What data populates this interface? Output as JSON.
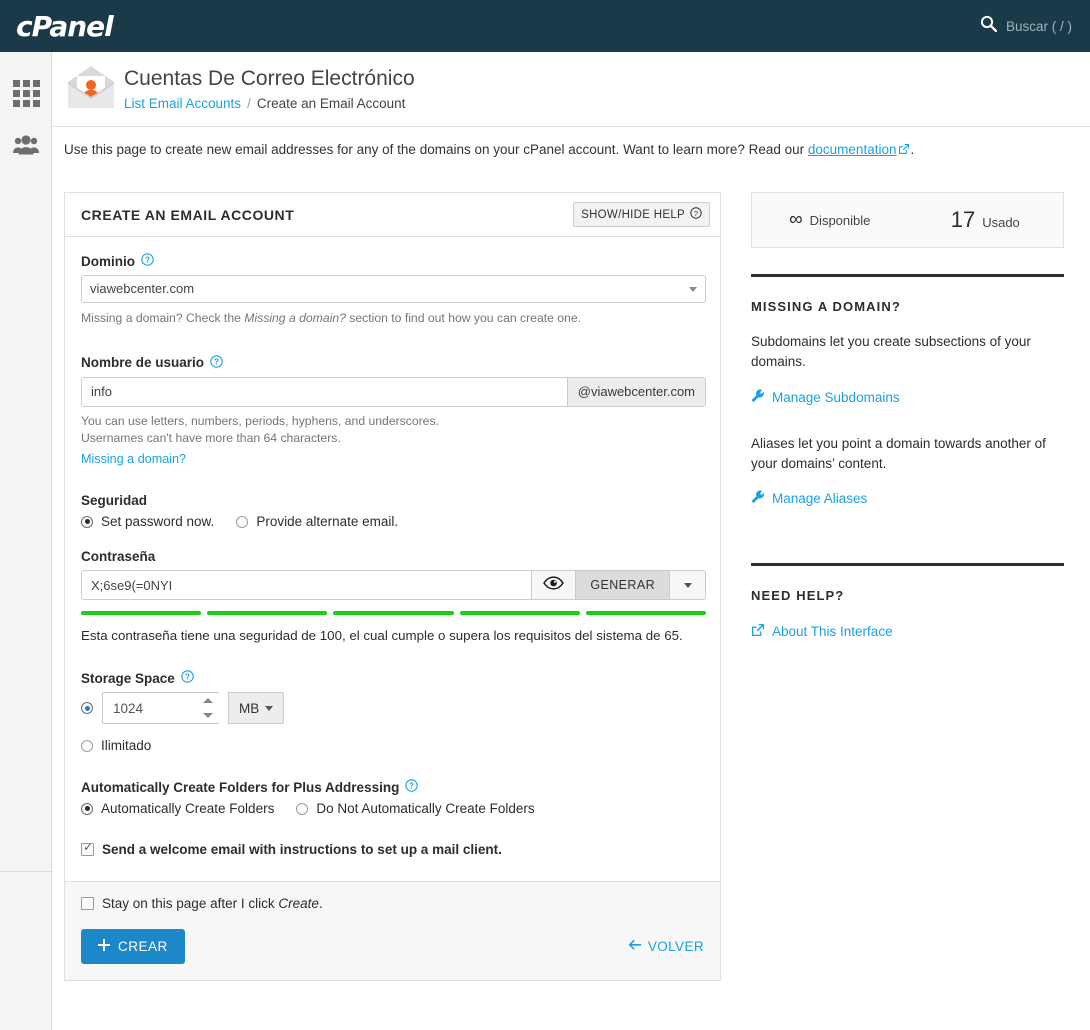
{
  "topbar": {
    "brand": "cPanel",
    "search_placeholder": "Buscar ( / )",
    "search_icon": "search-icon"
  },
  "rail": {
    "items": [
      {
        "icon": "grid-apps-icon",
        "name": "apps"
      },
      {
        "icon": "users-group-icon",
        "name": "users"
      }
    ]
  },
  "page_header": {
    "icon": "email-envelope-person-icon",
    "title": "Cuentas De Correo Electrónico",
    "breadcrumb": {
      "link": "List Email Accounts",
      "separator": "/",
      "current": "Create an Email Account"
    }
  },
  "intro": {
    "text_before": "Use this page to create new email addresses for any of the domains on your cPanel account. Want to learn more? Read our ",
    "link": "documentation",
    "text_after": "."
  },
  "form": {
    "title": "CREATE AN EMAIL ACCOUNT",
    "help_button": "SHOW/HIDE HELP",
    "domain": {
      "label": "Dominio",
      "value": "viawebcenter.com",
      "hint_before": "Missing a domain? Check the ",
      "hint_em": "Missing a domain?",
      "hint_after": " section to find out how you can create one."
    },
    "username": {
      "label": "Nombre de usuario",
      "value": "info",
      "addon": "@viawebcenter.com",
      "hint_line1": "You can use letters, numbers, periods, hyphens, and underscores.",
      "hint_line2": "Usernames can't have more than 64 characters.",
      "link": "Missing a domain?"
    },
    "security": {
      "label": "Seguridad",
      "option_set_password": "Set password now.",
      "option_alternate_email": "Provide alternate email.",
      "selected": "set_password"
    },
    "password": {
      "label": "Contraseña",
      "value": "X;6se9(=0NYI",
      "eye_icon": "eye-icon",
      "generate_button": "GENERAR",
      "caret_icon": "chevron-down-icon",
      "strength_segments": 5,
      "strength_color": "#16cf16",
      "message": "Esta contraseña tiene una seguridad de 100, el cual cumple o supera los requisitos del sistema de 65."
    },
    "storage": {
      "label": "Storage Space",
      "value": "1024",
      "unit": "MB",
      "unlimited_label": "Ilimitado",
      "selected": "fixed"
    },
    "plus_addressing": {
      "label": "Automatically Create Folders for Plus Addressing",
      "option_auto": "Automatically Create Folders",
      "option_manual": "Do Not Automatically Create Folders",
      "selected": "auto"
    },
    "welcome_email": {
      "label": "Send a welcome email with instructions to set up a mail client.",
      "checked": true
    },
    "stay_on_page": {
      "text_before": "Stay on this page after I click ",
      "text_em": "Create",
      "text_after": ".",
      "checked": false
    },
    "create_button": "CREAR",
    "back_button": "VOLVER"
  },
  "sidebar": {
    "stats": {
      "available_value": "∞",
      "available_label": "Disponible",
      "used_value": "17",
      "used_label": "Usado"
    },
    "missing_domain": {
      "title": "MISSING A DOMAIN?",
      "subdomains_text": "Subdomains let you create subsections of your domains.",
      "subdomains_link": "Manage Subdomains",
      "aliases_text": "Aliases let you point a domain towards another of your domains’ content.",
      "aliases_link": "Manage Aliases"
    },
    "need_help": {
      "title": "NEED HELP?",
      "link": "About This Interface"
    }
  },
  "colors": {
    "topbar": "#1a3a4a",
    "accent_link": "#1ba1e2",
    "primary_button": "#1c87c9",
    "strength_green": "#16cf16",
    "icon_orange": "#f26522"
  }
}
